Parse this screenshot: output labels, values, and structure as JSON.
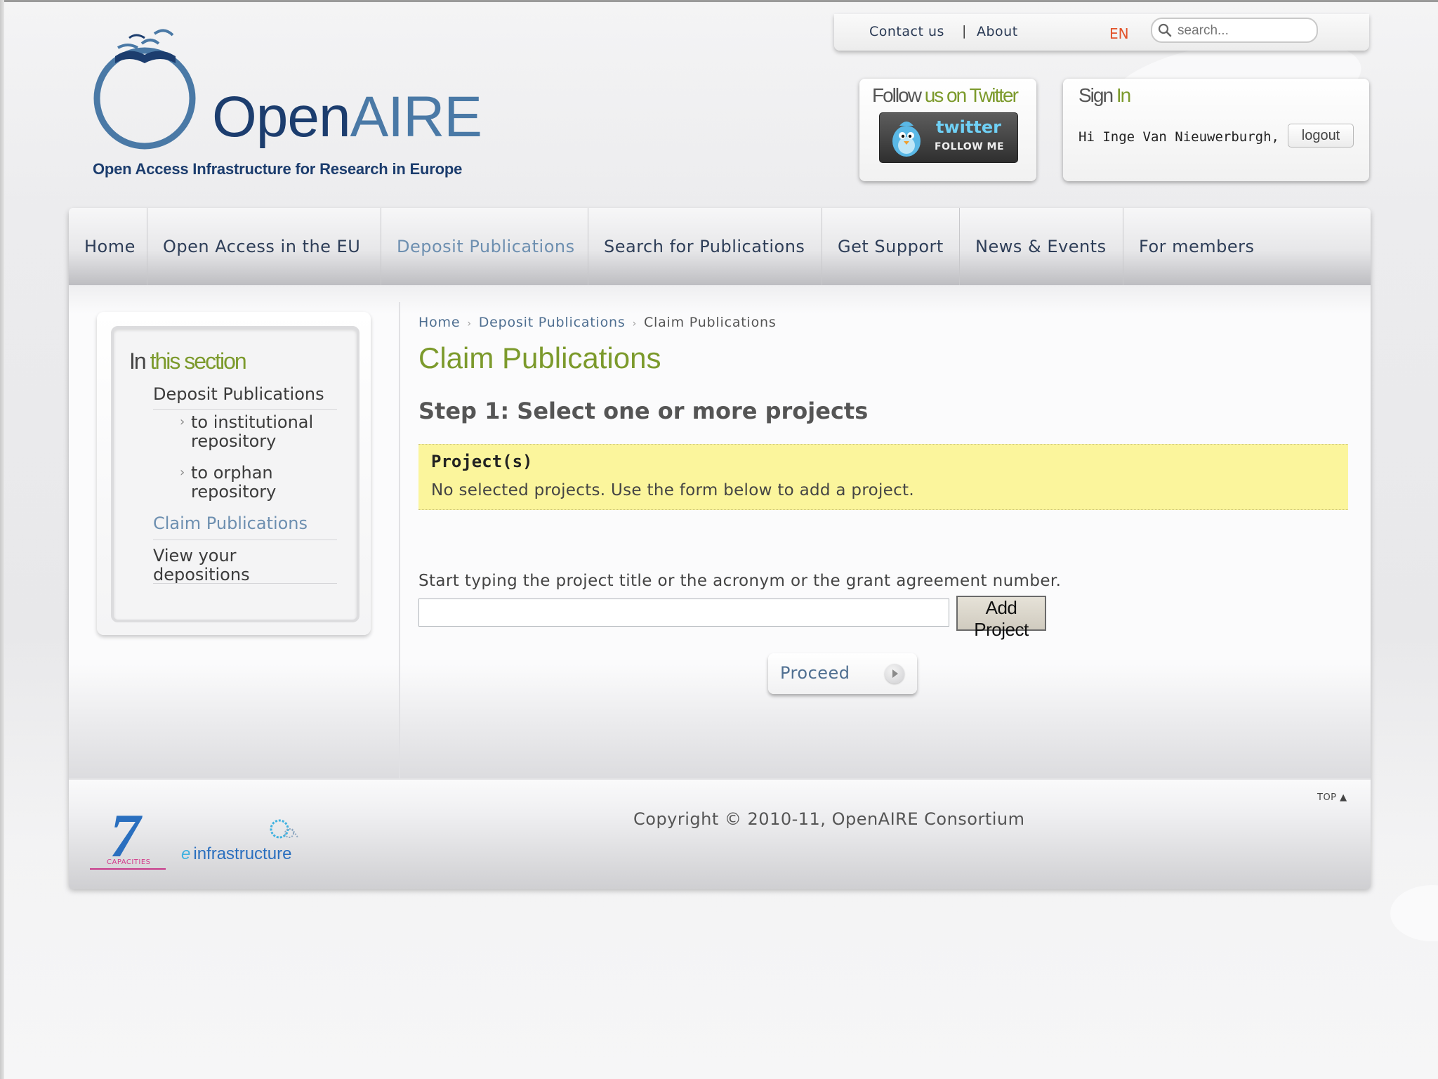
{
  "utility": {
    "contact_label": "Contact us",
    "separator": "|",
    "about_label": "About",
    "language": "EN",
    "search_placeholder": "search..."
  },
  "logo": {
    "wordmark_open": "Open",
    "wordmark_aire": "AIRE",
    "tagline": "Open Access Infrastructure for Research in Europe"
  },
  "twitter": {
    "title_prefix": "Follow ",
    "title_highlight": "us on Twitter",
    "badge_brand": "twitter",
    "badge_follow": "FOLLOW ME"
  },
  "signin": {
    "title_prefix": "Sign ",
    "title_highlight": "In",
    "greeting": "Hi Inge Van Nieuwerburgh,",
    "logout_label": "logout"
  },
  "nav": {
    "items": [
      {
        "label": "Home"
      },
      {
        "label": "Open Access in the EU"
      },
      {
        "label": "Deposit Publications"
      },
      {
        "label": "Search for Publications"
      },
      {
        "label": "Get Support"
      },
      {
        "label": "News & Events"
      },
      {
        "label": "For members"
      }
    ],
    "active_index": 2
  },
  "section": {
    "title_prefix": "In ",
    "title_highlight": "this section",
    "links": {
      "deposit": "Deposit Publications",
      "to_institutional": "to institutional repository",
      "to_orphan": "to orphan repository",
      "claim": "Claim Publications",
      "view": "View your depositions"
    }
  },
  "breadcrumb": {
    "home": "Home",
    "deposit": "Deposit Publications",
    "current": "Claim Publications",
    "separator": "›"
  },
  "main": {
    "page_title": "Claim Publications",
    "step_title": "Step 1: Select one or more projects",
    "projects_title": "Project(s)",
    "projects_message": "No selected projects. Use the form below to add a project.",
    "helper_text": "Start typing the project title or the acronym or the grant agreement number.",
    "project_input_value": "",
    "add_project_label": "Add Project",
    "proceed_label": "Proceed"
  },
  "footer": {
    "copyright": "Copyright © 2010-11, OpenAIRE Consortium",
    "top_label": "TOP ▲",
    "fp7_number": "7",
    "fp7_caption": "CAPACITIES",
    "einfra_e": "e",
    "einfra_text": "infrastructure"
  },
  "colors": {
    "accent_green": "#7c9a2c",
    "link_blue": "#4f6f91",
    "brand_navy": "#1c3d6e",
    "highlight_yellow": "#fbf59c",
    "language_orange": "#e2532a"
  }
}
